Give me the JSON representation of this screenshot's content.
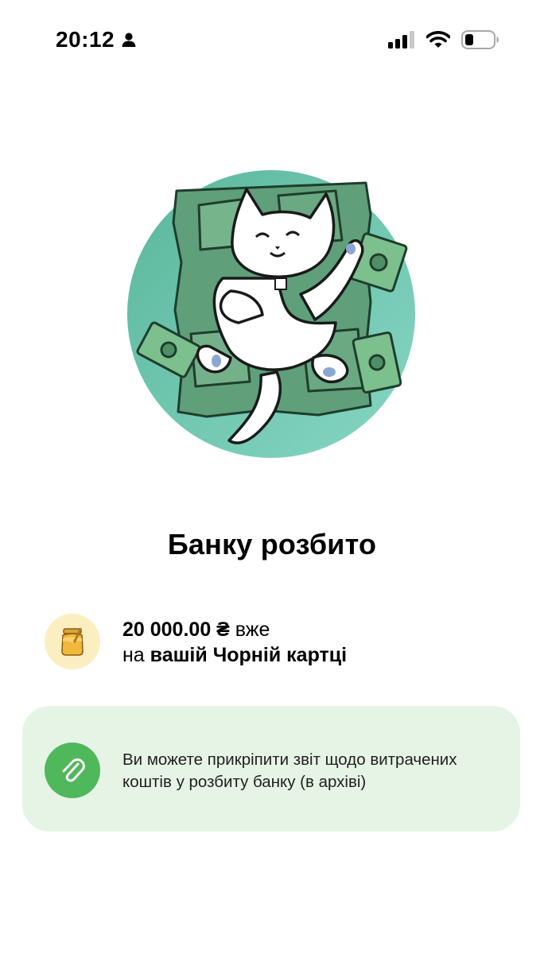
{
  "status_bar": {
    "time": "20:12",
    "icons": [
      "person-icon",
      "cellular-signal-icon",
      "wifi-icon",
      "battery-icon"
    ]
  },
  "illustration": {
    "icon": "cat-on-money-illustration",
    "colors": {
      "circle": "#6cc3a8",
      "money": "#6aa981"
    }
  },
  "title": "Банку розбито",
  "summary": {
    "icon": "honey-jar-icon",
    "amount": "20 000.00 ₴",
    "amount_suffix": " вже",
    "line2_prefix": "на ",
    "line2_bold": "вашій Чорній картці"
  },
  "attach_card": {
    "icon": "paperclip-icon",
    "text": "Ви можете прикріпити звіт щодо витрачених коштів у розбиту банку (в архіві)",
    "colors": {
      "background": "#e6f4e6",
      "icon_background": "#4fb85a"
    }
  }
}
